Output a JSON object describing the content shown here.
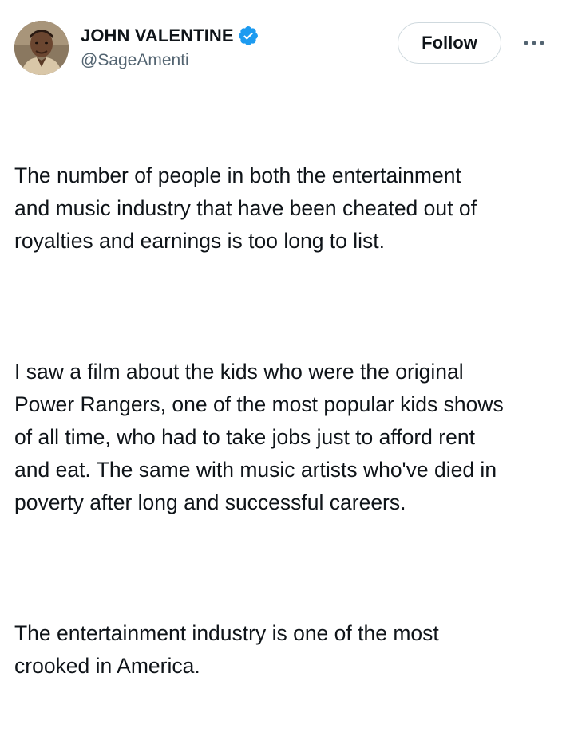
{
  "author": {
    "display_name": "JOHN VALENTINE",
    "handle": "@SageAmenti",
    "verified": true,
    "verified_color": "#1d9bf0"
  },
  "actions": {
    "follow_label": "Follow",
    "more_icon": "more-horizontal-icon"
  },
  "tweet": {
    "paragraphs": [
      "The number of people in both the entertainment\nand music industry that have been cheated out of\nroyalties and earnings is too long to list.",
      "I saw a film about the kids who were the original\nPower Rangers, one of the most popular kids shows\nof all time, who had to take jobs just to afford rent\nand eat. The same with music artists who've died in\npoverty after long and successful careers.",
      "The entertainment industry is one of the most\ncrooked in America."
    ]
  },
  "colors": {
    "text": "#0f1419",
    "secondary_text": "#536471",
    "border": "#cfd9de"
  }
}
